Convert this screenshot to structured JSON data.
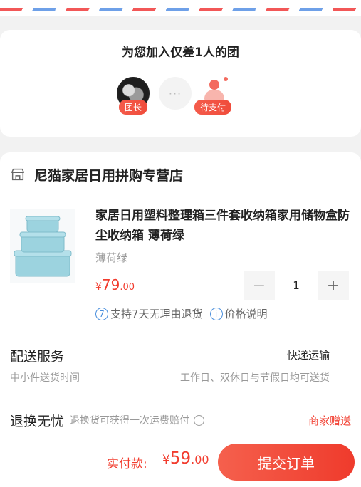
{
  "group": {
    "title": "为您加入仅差1人的团",
    "leader_badge": "团长",
    "more": "···",
    "waiting_badge": "待支付"
  },
  "store": {
    "name": "尼猫家居日用拼购专营店"
  },
  "product": {
    "title": "家居日用塑料整理箱三件套收纳箱家用储物盒防尘收纳箱 薄荷绿",
    "spec": "薄荷绿",
    "price_symbol": "¥",
    "price_int": "79",
    "price_dec": ".00",
    "quantity": "1",
    "minus": "−",
    "plus": "+",
    "policies": [
      {
        "icon": "7",
        "label": "支持7天无理由退货"
      },
      {
        "icon": "i",
        "label": "价格说明"
      }
    ],
    "image_color": "#9cd3df"
  },
  "delivery": {
    "title": "配送服务",
    "method": "快递运输",
    "subtitle": "中小件送货时间",
    "days": "工作日、双休日与节假日均可送货"
  },
  "returns": {
    "title": "退换无忧",
    "desc": "退换货可获得一次运费赔付",
    "gift": "商家赠送"
  },
  "checkout": {
    "label": "实付款:",
    "symbol": "¥",
    "amount_int": "59",
    "amount_dec": ".00",
    "submit": "提交订单"
  },
  "colors": {
    "accent": "#f23c2e",
    "link_blue": "#4a8fdd"
  }
}
